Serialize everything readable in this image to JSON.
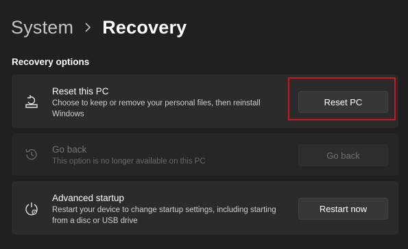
{
  "breadcrumb": {
    "parent": "System",
    "current": "Recovery"
  },
  "section": {
    "title": "Recovery options"
  },
  "cards": [
    {
      "title": "Reset this PC",
      "description": "Choose to keep or remove your personal files, then reinstall Windows",
      "button": "Reset PC",
      "icon": "reset-pc-icon",
      "enabled": true
    },
    {
      "title": "Go back",
      "description": "This option is no longer available on this PC",
      "button": "Go back",
      "icon": "history-icon",
      "enabled": false
    },
    {
      "title": "Advanced startup",
      "description": "Restart your device to change startup settings, including starting from a disc or USB drive",
      "button": "Restart now",
      "icon": "advanced-startup-icon",
      "enabled": true
    }
  ],
  "colors": {
    "background": "#202020",
    "card": "#2b2b2b",
    "highlight": "#d0161c"
  }
}
